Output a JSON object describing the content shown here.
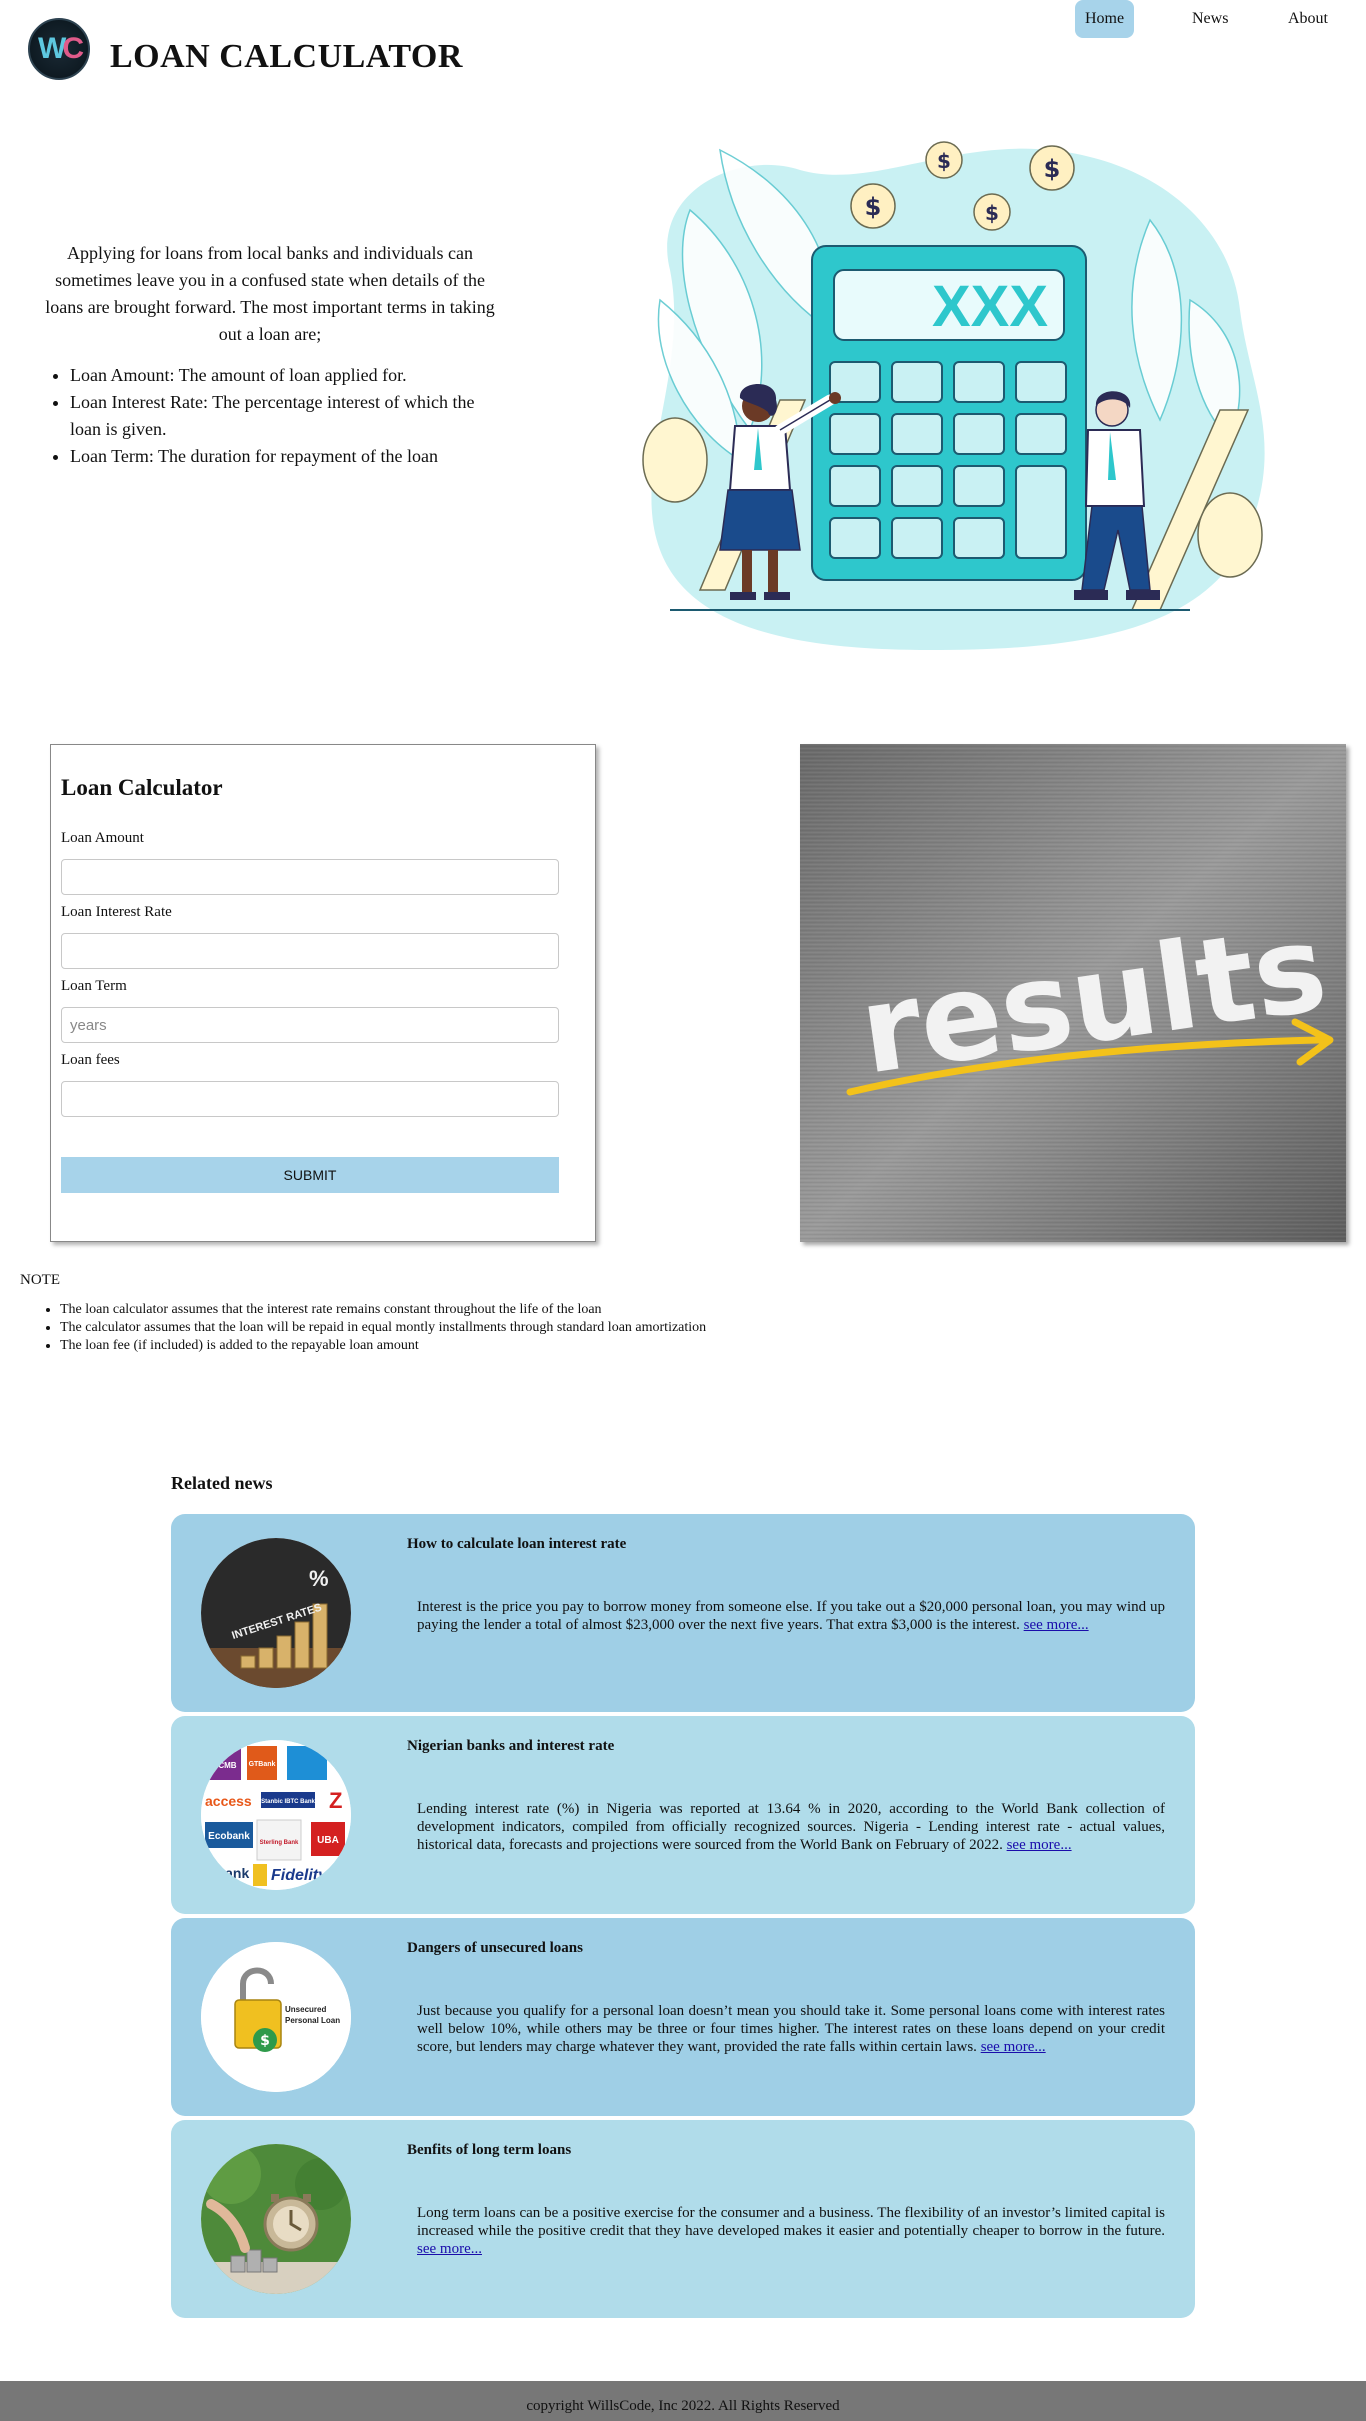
{
  "header": {
    "logo_text_w": "W",
    "logo_text_c": "C",
    "site_title": "LOAN CALCULATOR",
    "nav": {
      "home": "Home",
      "news": "News",
      "about": "About"
    }
  },
  "intro": {
    "paragraph": "Applying for loans from local banks and individuals can sometimes leave you in a confused state when details of the loans are brought forward. The most important terms in taking out a loan are;",
    "terms": [
      "Loan Amount: The amount of loan applied for.",
      "Loan Interest Rate: The percentage interest of which the loan is given.",
      "Loan Term: The duration for repayment of the loan"
    ]
  },
  "hero": {
    "calculator_display": "XXX"
  },
  "form": {
    "title": "Loan Calculator",
    "amount_label": "Loan Amount",
    "amount_value": "",
    "rate_label": "Loan Interest Rate",
    "rate_value": "",
    "term_label": "Loan Term",
    "term_placeholder": "years",
    "fees_label": "Loan fees",
    "fees_value": "",
    "submit_label": "SUBMIT"
  },
  "results_image": {
    "word": "results"
  },
  "note": {
    "title": "NOTE",
    "items": [
      "The loan calculator assumes that the interest rate remains constant throughout the life of the loan",
      "The calculator assumes that the loan will be repaid in equal montly installments through standard loan amortization",
      "The loan fee (if included) is added to the repayable loan amount"
    ]
  },
  "related": {
    "title": "Related news",
    "items": [
      {
        "title": "How to calculate loan interest rate",
        "body": "Interest is the price you pay to borrow money from someone else. If you take out a $20,000 personal loan, you may wind up paying the lender a total of almost $23,000 over the next five years. That extra $3,000 is the interest.",
        "link": "see more...",
        "thumb_text": "INTEREST RATES"
      },
      {
        "title": "Nigerian banks and interest rate",
        "body": "Lending interest rate (%) in Nigeria was reported at 13.64 % in 2020, according to the World Bank collection of development indicators, compiled from officially recognized sources. Nigeria - Lending interest rate - actual values, historical data, forecasts and projections were sourced from the World Bank on February of 2022.",
        "link": "see more...",
        "thumb_labels": [
          "FCMB",
          "GTBank",
          "access",
          "Stanbic IBTC Bank",
          "Z",
          "Ecobank",
          "Sterling Bank",
          "UBA",
          "Bank",
          "Fidelity"
        ]
      },
      {
        "title": "Dangers of unsecured loans",
        "body": "Just because you qualify for a personal loan doesn’t mean you should take it. Some personal loans come with interest rates well below 10%, while others may be three or four times higher. The interest rates on these loans depend on your credit score, but lenders may charge whatever they want, provided the rate falls within certain laws.",
        "link": "see more...",
        "thumb_text": "Unsecured Personal Loan"
      },
      {
        "title": "Benfits of long term loans",
        "body": "Long term loans can be a positive exercise for the consumer and a business. The flexibility of an investor’s limited capital is increased while the positive credit that they have developed makes it easier and potentially cheaper to borrow in the future.",
        "link": "see more..."
      }
    ]
  },
  "footer": {
    "text": "copyright WillsCode, Inc 2022. All Rights Reserved"
  }
}
